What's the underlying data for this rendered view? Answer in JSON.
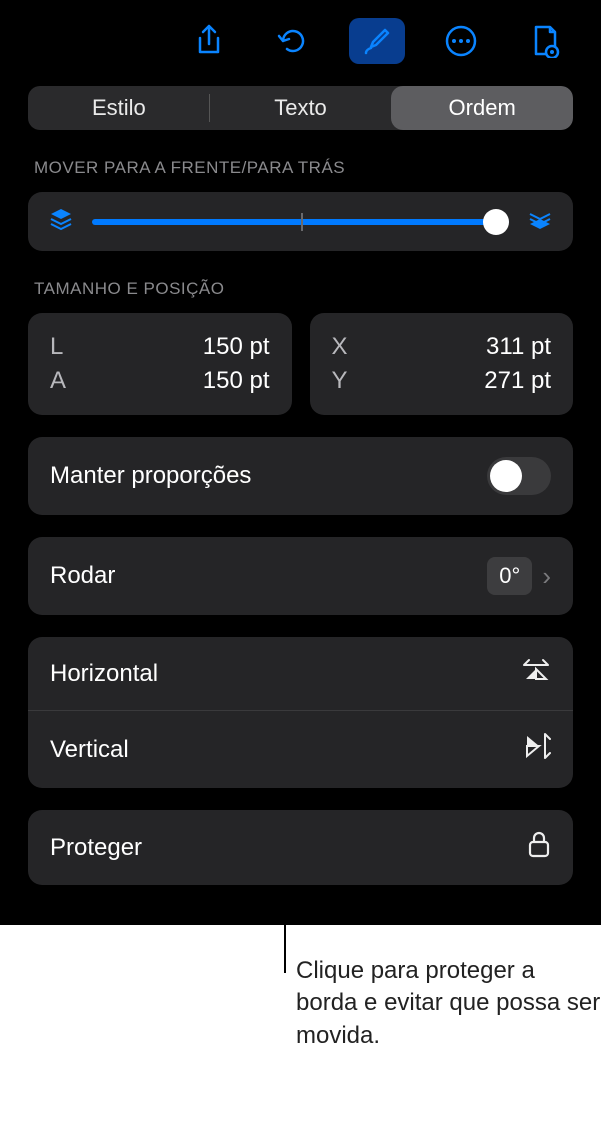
{
  "tabs": {
    "style": "Estilo",
    "text": "Texto",
    "order": "Ordem"
  },
  "layer": {
    "section": "Mover para a frente/para trás"
  },
  "sizepos": {
    "section": "Tamanho e posição",
    "wLabel": "L",
    "wVal": "150 pt",
    "hLabel": "A",
    "hVal": "150 pt",
    "xLabel": "X",
    "xVal": "311 pt",
    "yLabel": "Y",
    "yVal": "271 pt"
  },
  "aspect": {
    "label": "Manter proporções"
  },
  "rotate": {
    "label": "Rodar",
    "value": "0°"
  },
  "flip": {
    "h": "Horizontal",
    "v": "Vertical"
  },
  "lock": {
    "label": "Proteger"
  },
  "callout": "Clique para proteger a borda e evitar que possa ser movida."
}
